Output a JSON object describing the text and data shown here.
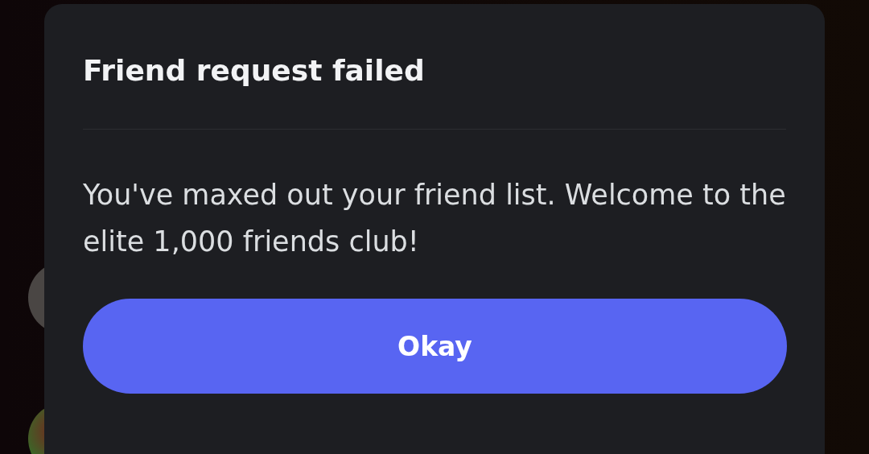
{
  "dialog": {
    "title": "Friend request failed",
    "message": "You've maxed out your friend list. Welcome to the elite 1,000 friends club!",
    "button": "Okay"
  }
}
